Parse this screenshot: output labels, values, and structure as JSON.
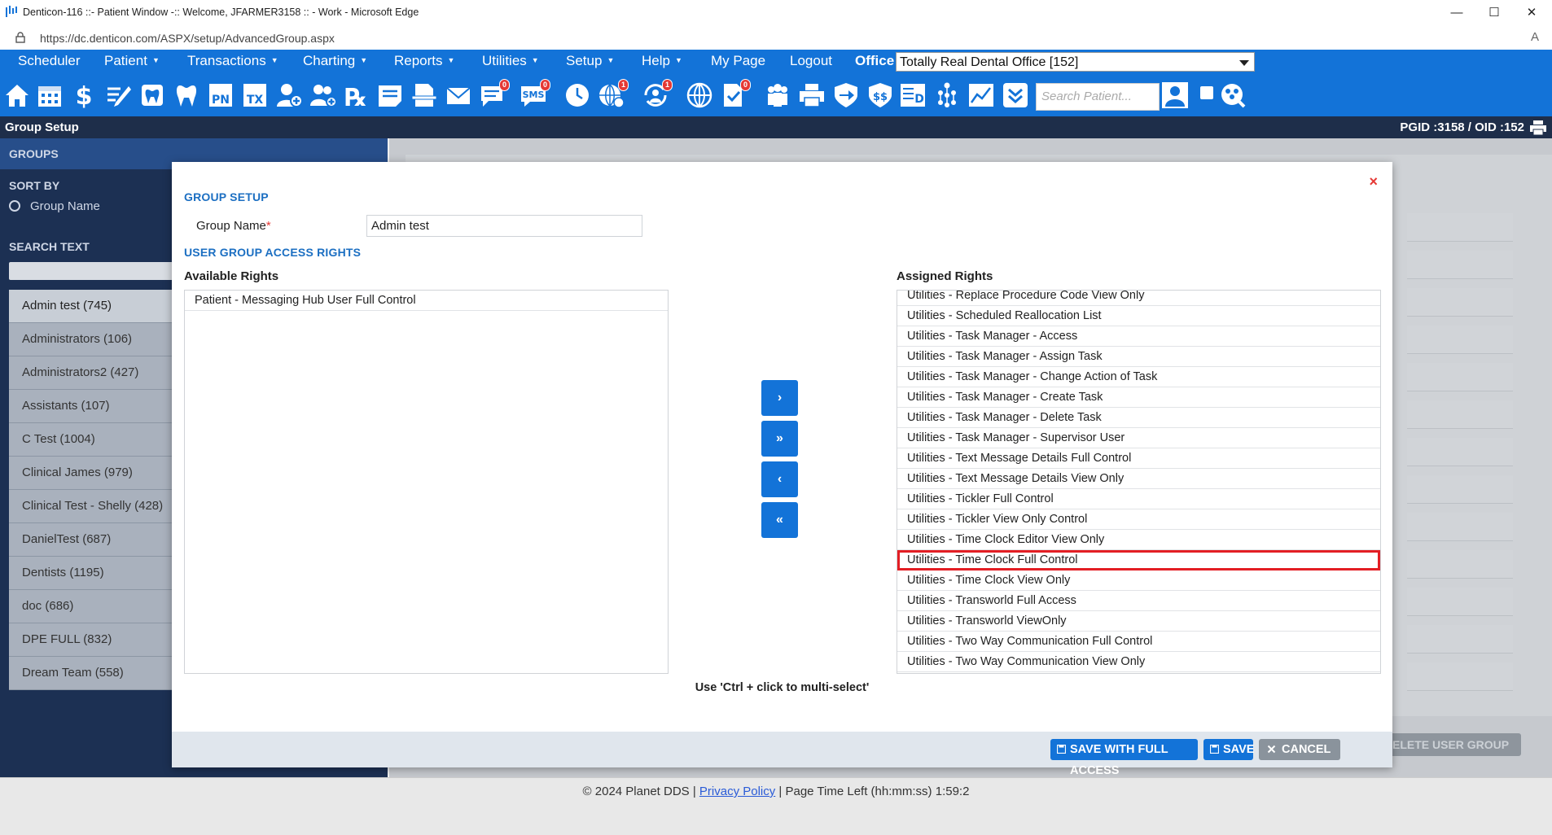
{
  "browser": {
    "title": "Denticon-116 ::- Patient Window -:: Welcome, JFARMER3158 :: - Work - Microsoft Edge",
    "url": "https://dc.denticon.com/ASPX/setup/AdvancedGroup.aspx",
    "minimize": "—",
    "maximize": "☐",
    "close": "✕",
    "reader": "A"
  },
  "menu": {
    "items": [
      "Scheduler",
      "Patient",
      "Transactions",
      "Charting",
      "Reports",
      "Utilities",
      "Setup",
      "Help",
      "My Page",
      "Logout"
    ],
    "office_label": "Office",
    "office_value": "Totally Real Dental Office [152]"
  },
  "toolbar": {
    "search_placeholder": "Search Patient...",
    "badges": {
      "messages": "0",
      "sms": "0",
      "alerts": "1",
      "sync": "1",
      "docs": "0"
    }
  },
  "pagebar": {
    "title": "Group Setup",
    "ids": "PGID :3158  /  OID :152"
  },
  "left": {
    "groups_header": "GROUPS",
    "sort_by": "SORT BY",
    "sort_option": "Group Name",
    "search_text": "SEARCH TEXT",
    "groups": [
      "Admin test (745)",
      "Administrators (106)",
      "Administrators2 (427)",
      "Assistants (107)",
      "C Test (1004)",
      "Clinical James (979)",
      "Clinical Test - Shelly (428)",
      "DanielTest (687)",
      "Dentists (1195)",
      "doc (686)",
      "DPE FULL (832)",
      "Dream Team (558)"
    ]
  },
  "background_buttons": {
    "delete": "ELETE USER GROUP"
  },
  "modal": {
    "section_group_setup": "GROUP SETUP",
    "group_name_label": "Group Name",
    "required_mark": "*",
    "group_name_value": "Admin test",
    "section_access": "USER GROUP ACCESS RIGHTS",
    "available_label": "Available Rights",
    "assigned_label": "Assigned Rights",
    "available": [
      "Patient - Messaging Hub User Full Control"
    ],
    "assigned": [
      "Utilities - Replace Procedure Code View Only",
      "Utilities - Scheduled Reallocation List",
      "Utilities - Task Manager - Access",
      "Utilities - Task Manager - Assign Task",
      "Utilities - Task Manager - Change Action of Task",
      "Utilities - Task Manager - Create Task",
      "Utilities - Task Manager - Delete Task",
      "Utilities - Task Manager - Supervisor User",
      "Utilities - Text Message Details Full Control",
      "Utilities - Text Message Details View Only",
      "Utilities - Tickler Full Control",
      "Utilities - Tickler View Only Control",
      "Utilities - Time Clock Editor View Only",
      "Utilities - Time Clock Full Control",
      "Utilities - Time Clock View Only",
      "Utilities - Transworld Full Access",
      "Utilities - Transworld ViewOnly",
      "Utilities - Two Way Communication Full Control",
      "Utilities - Two Way Communication View Only"
    ],
    "highlighted_assigned": "Utilities - Time Clock Full Control",
    "move_buttons": [
      "›",
      "»",
      "‹",
      "«"
    ],
    "hint": "Use 'Ctrl + click to multi-select'",
    "close": "×",
    "save_full": "SAVE WITH FULL ACCESS",
    "save": "SAVE",
    "cancel": "CANCEL"
  },
  "footer": {
    "copyright": "© 2024 Planet DDS | ",
    "privacy": "Privacy Policy",
    "time_left": " |  Page Time Left (hh:mm:ss) 1:59:2"
  },
  "colors": {
    "brand_blue": "#1373d8",
    "dark_nav": "#1e2e4a",
    "highlight_red": "#e31e24"
  }
}
